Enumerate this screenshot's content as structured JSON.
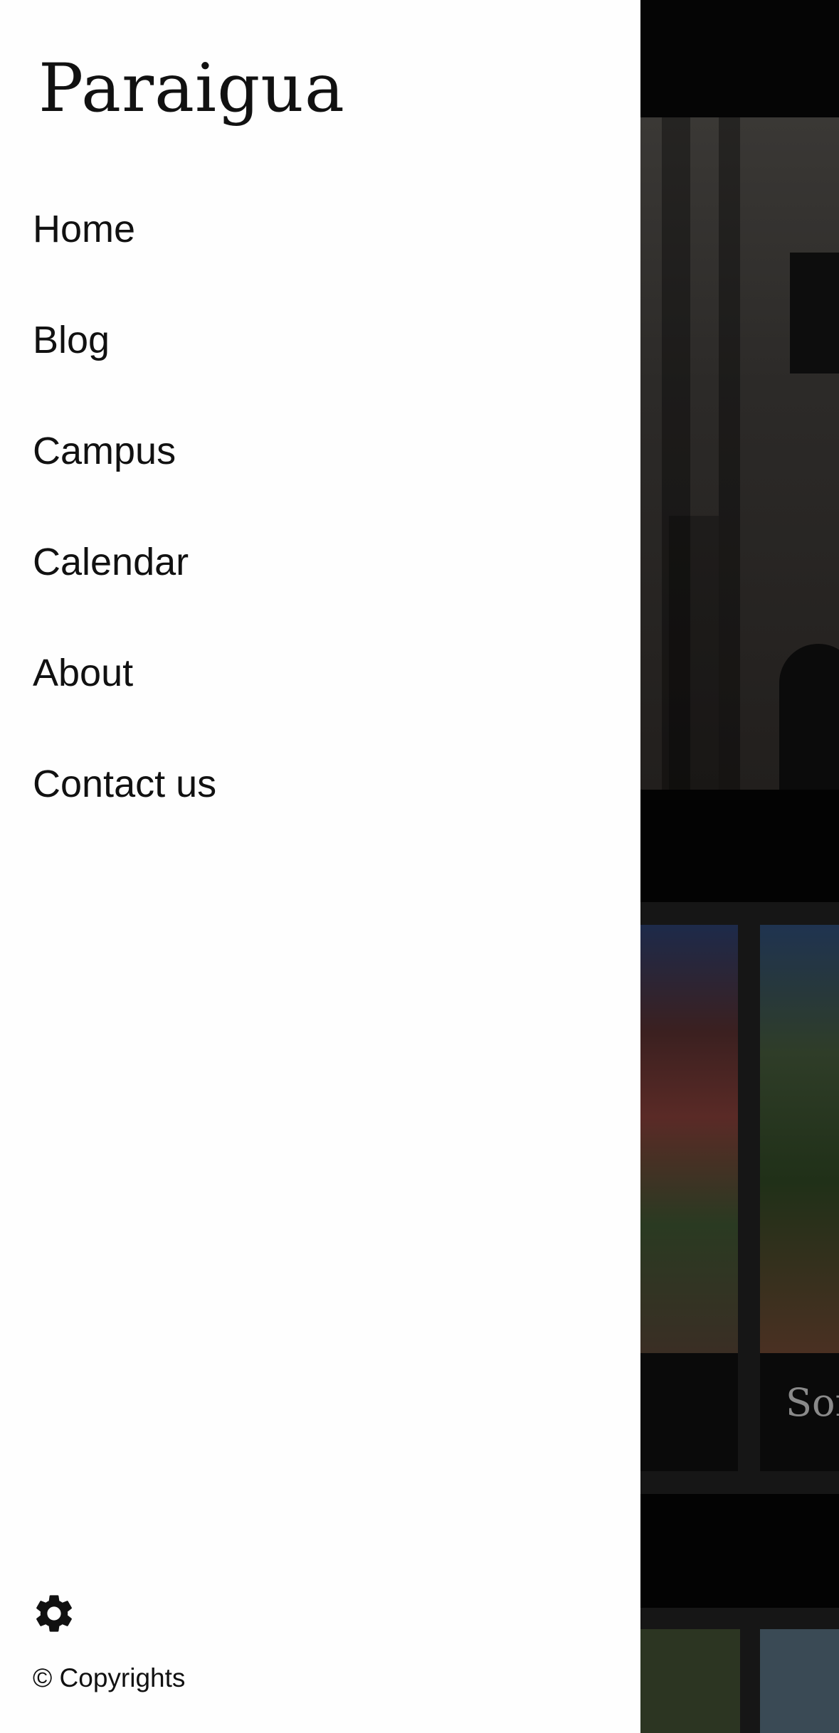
{
  "drawer": {
    "brand": "Paraigua",
    "nav": [
      {
        "label": "Home"
      },
      {
        "label": "Blog"
      },
      {
        "label": "Campus"
      },
      {
        "label": "Calendar"
      },
      {
        "label": "About"
      },
      {
        "label": "Contact us"
      }
    ],
    "settings_icon": "gear-icon",
    "copyright": "© Copyrights"
  },
  "background": {
    "card_title_partial": "Sor"
  },
  "colors": {
    "drawer_bg": "#fefefe",
    "overlay_bg": "#000000",
    "text": "#111111"
  }
}
